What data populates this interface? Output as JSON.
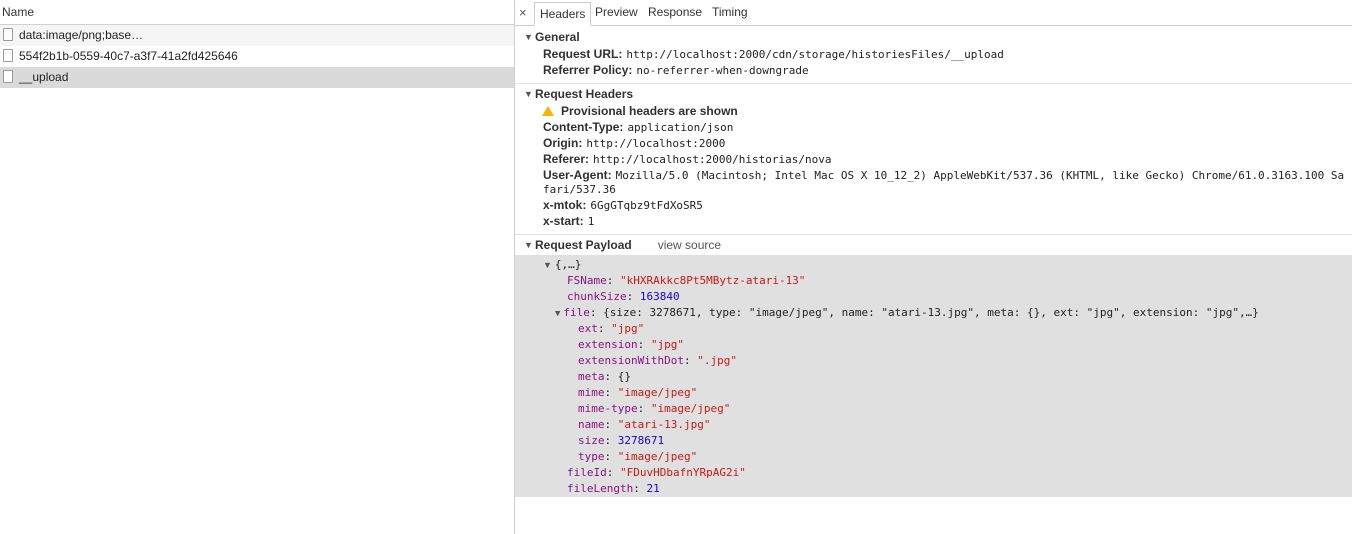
{
  "left": {
    "header": "Name",
    "rows": [
      {
        "name": "data:image/png;base…"
      },
      {
        "name": "554f2b1b-0559-40c7-a3f7-41a2fd425646"
      },
      {
        "name": "__upload"
      }
    ]
  },
  "tabs": {
    "close": "×",
    "items": [
      "Headers",
      "Preview",
      "Response",
      "Timing"
    ]
  },
  "general": {
    "title": "General",
    "request_url_label": "Request URL:",
    "request_url": "http://localhost:2000/cdn/storage/historiesFiles/__upload",
    "referrer_policy_label": "Referrer Policy:",
    "referrer_policy": "no-referrer-when-downgrade"
  },
  "request_headers": {
    "title": "Request Headers",
    "provisional": "Provisional headers are shown",
    "content_type_label": "Content-Type:",
    "content_type": "application/json",
    "origin_label": "Origin:",
    "origin": "http://localhost:2000",
    "referer_label": "Referer:",
    "referer": "http://localhost:2000/historias/nova",
    "user_agent_label": "User-Agent:",
    "user_agent_line1": "Mozilla/5.0 (Macintosh; Intel Mac OS X 10_12_2) AppleWebKit/537.36 (KHTML, like Gecko) Chrome/61.0.3163.100 Sa",
    "user_agent_line2": "fari/537.36",
    "xmtok_label": "x-mtok:",
    "xmtok": "6GgGTqbz9tFdXoSR5",
    "xstart_label": "x-start:",
    "xstart": "1"
  },
  "payload": {
    "title": "Request Payload",
    "view_source": "view source",
    "root": "{,…}",
    "fsname_key": "FSName",
    "fsname": "\"kHXRAkkc8Pt5MBytz-atari-13\"",
    "chunksize_key": "chunkSize",
    "chunksize": "163840",
    "file_key": "file",
    "file_summary": "{size: 3278671, type: \"image/jpeg\", name: \"atari-13.jpg\", meta: {}, ext: \"jpg\", extension: \"jpg\",…}",
    "ext_key": "ext",
    "ext": "\"jpg\"",
    "extension_key": "extension",
    "extension": "\"jpg\"",
    "extdot_key": "extensionWithDot",
    "extdot": "\".jpg\"",
    "meta_key": "meta",
    "meta": "{}",
    "mime_key": "mime",
    "mime": "\"image/jpeg\"",
    "mimetype_key": "mime-type",
    "mimetype": "\"image/jpeg\"",
    "name_key": "name",
    "name": "\"atari-13.jpg\"",
    "size_key": "size",
    "size": "3278671",
    "type_key": "type",
    "type": "\"image/jpeg\"",
    "fileid_key": "fileId",
    "fileid": "\"FDuvHDbafnYRpAG2i\"",
    "filelength_key": "fileLength",
    "filelength": "21"
  }
}
